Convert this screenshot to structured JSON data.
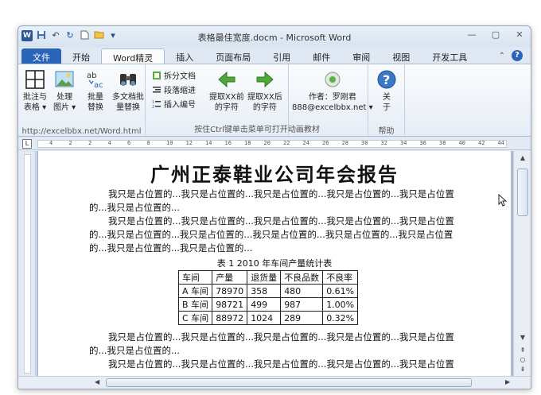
{
  "window": {
    "title": "表格最佳宽度.docm - Microsoft Word"
  },
  "tabs": [
    {
      "label": "文件"
    },
    {
      "label": "开始"
    },
    {
      "label": "Word精灵"
    },
    {
      "label": "插入"
    },
    {
      "label": "页面布局"
    },
    {
      "label": "引用"
    },
    {
      "label": "邮件"
    },
    {
      "label": "审阅"
    },
    {
      "label": "视图"
    },
    {
      "label": "开发工具"
    }
  ],
  "ribbon": {
    "btn_annotate": {
      "line1": "批注与",
      "line2": "表格 ▾"
    },
    "btn_image": {
      "line1": "处理",
      "line2": "图片 ▾"
    },
    "btn_batch": {
      "line1": "批量",
      "line2": "替换"
    },
    "btn_multi": {
      "line1": "多文档批",
      "line2": "量替换"
    },
    "btn_split": "拆分文档",
    "btn_indent": "段落缩进",
    "btn_number": "插入编号",
    "btn_prev": {
      "line1": "提取XX前",
      "line2": "的字符"
    },
    "btn_next": {
      "line1": "提取XX后",
      "line2": "的字符"
    },
    "author": {
      "line1": "作者：罗刚君",
      "line2": "888@excelbbx.net ▾"
    },
    "btn_about": {
      "line1": "关",
      "line2": "于"
    },
    "group1_label": "http://excelbbx.net/Word.html",
    "group2_label": "按住Ctrl键单击菜单可打开动画教材",
    "group3_label": "帮助"
  },
  "ruler": {
    "numbers": [
      "4",
      "2",
      "2",
      "4",
      "6",
      "8",
      "10",
      "12",
      "14",
      "16",
      "18",
      "20",
      "22",
      "24",
      "26",
      "28",
      "30",
      "32",
      "34",
      "36",
      "38",
      "40",
      "42",
      "44"
    ]
  },
  "document": {
    "title": "广州正泰鞋业公司年会报告",
    "para1_l1": "我只是占位置的...我只是占位置的...我只是占位置的...我只是占位置的...我只是占位置",
    "para1_l2": "的...我只是占位置的...",
    "para2_l1": "我只是占位置的...我只是占位置的...我只是占位置的...我只是占位置的...我只是占位置",
    "para2_l2": "的...我只是占位置的...我只是占位置的...我只是占位置的...我只是占位置的...我只是占位置",
    "para2_l3": "的...我只是占位置的...我只是占位置的...",
    "caption": "表 1   2010 年车间产量统计表",
    "table": {
      "headers": [
        "车间",
        "产量",
        "退货量",
        "不良品数",
        "不良率"
      ],
      "rows": [
        [
          "A 车间",
          "78970",
          "358",
          "480",
          "0.61%"
        ],
        [
          "B 车间",
          "98721",
          "499",
          "987",
          "1.00%"
        ],
        [
          "C 车间",
          "88972",
          "1024",
          "289",
          "0.32%"
        ]
      ]
    },
    "para3_l1": "我只是占位置的...我只是占位置的...我只是占位置的...我只是占位置的...我只是占位置",
    "para3_l2": "的...我只是占位置的...",
    "para4_l1": "我只是占位置的...我只是占位置的...我只是占位置的...我只是占位置的...我只是占位置"
  },
  "colors": {
    "accent": "#2a64b8",
    "ribbon_bg": "#e6edf6"
  }
}
